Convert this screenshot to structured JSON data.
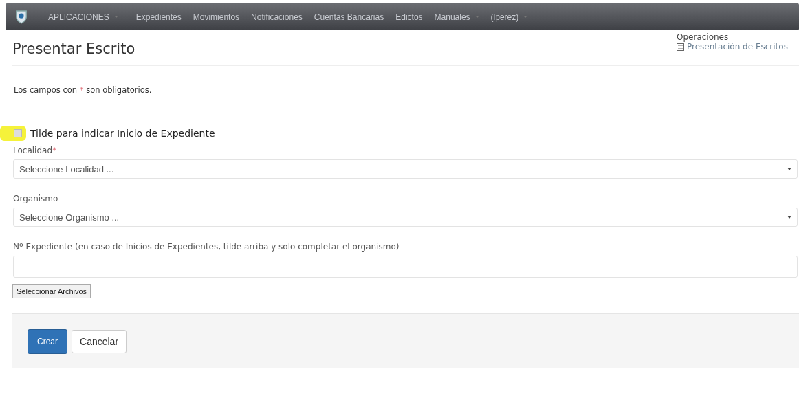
{
  "navbar": {
    "items": [
      {
        "label": "APLICACIONES",
        "dropdown": true
      },
      {
        "label": "Expedientes",
        "dropdown": false
      },
      {
        "label": "Movimientos",
        "dropdown": false
      },
      {
        "label": "Notificaciones",
        "dropdown": false
      },
      {
        "label": "Cuentas Bancarias",
        "dropdown": false
      },
      {
        "label": "Edictos",
        "dropdown": false
      },
      {
        "label": "Manuales",
        "dropdown": true
      },
      {
        "label": "(lperez)",
        "dropdown": true
      }
    ]
  },
  "page_title": "Presentar Escrito",
  "operations": {
    "title": "Operaciones",
    "links": [
      "Presentación de Escritos"
    ]
  },
  "required_note": {
    "before": "Los campos con",
    "mark": "*",
    "after": "son obligatorios."
  },
  "start_checkbox": {
    "label": "Tilde para indicar Inicio de Expediente",
    "checked": false,
    "highlighted": true
  },
  "fields": [
    {
      "kind": "select",
      "label": "Localidad",
      "required_mark": "*",
      "placeholder": "Seleccione Localidad ..."
    },
    {
      "kind": "select",
      "label": "Organismo",
      "placeholder": "Seleccione Organismo ..."
    },
    {
      "kind": "text",
      "label": "Nº Expediente (en caso de Inicios de Expedientes, tilde arriba y solo completar el organismo)"
    }
  ],
  "file_button": "Seleccionar Archivos",
  "actions": [
    {
      "label": "Crear",
      "primary": true
    },
    {
      "label": "Cancelar",
      "primary": false
    }
  ]
}
